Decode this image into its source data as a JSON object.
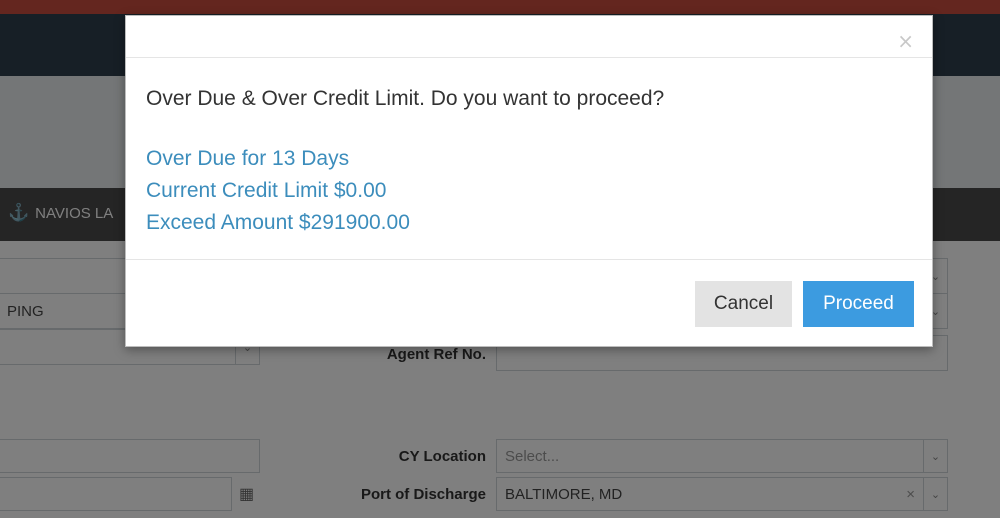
{
  "background": {
    "tab": {
      "icon": "anchor-icon",
      "label": "NAVIOS LA"
    },
    "fields": {
      "shipper_partial": "PING",
      "agent_ref_label": "Agent Ref No.",
      "cy_location_label": "CY Location",
      "cy_location_placeholder": "Select...",
      "port_of_discharge_label": "Port of Discharge",
      "port_of_discharge_value": "BALTIMORE, MD"
    }
  },
  "modal": {
    "close_symbol": "×",
    "message": "Over Due & Over Credit Limit. Do you want to proceed?",
    "details": [
      "Over Due for 13 Days",
      "Current Credit Limit $0.00",
      "Exceed Amount $291900.00"
    ],
    "buttons": {
      "cancel": "Cancel",
      "proceed": "Proceed"
    }
  },
  "colors": {
    "top_bar": "#c94d3e",
    "navbar": "#2f3e4c",
    "detail_text": "#3c8dbc",
    "proceed_button": "#3c9be0",
    "cancel_button": "#e3e3e3"
  }
}
